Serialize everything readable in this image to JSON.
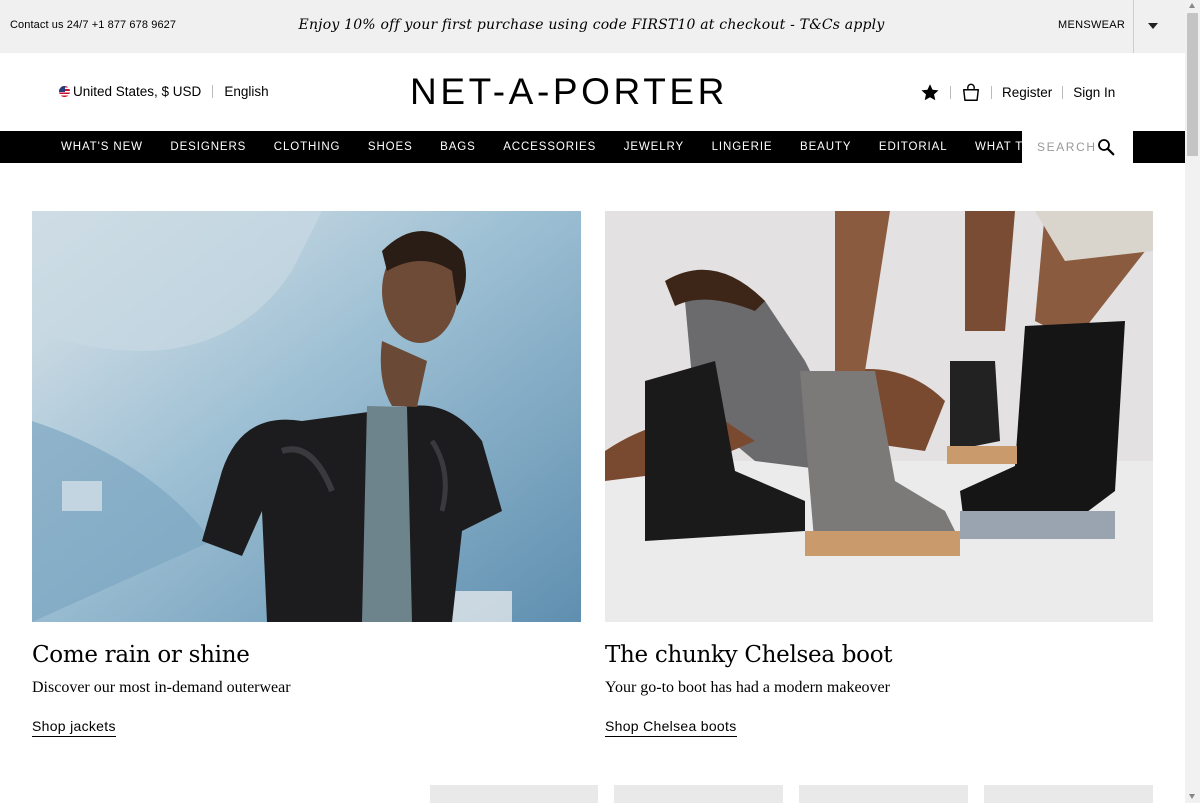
{
  "promo": {
    "contact": "Contact us 24/7 +1 877 678 9627",
    "message": "Enjoy 10% off your first purchase using code FIRST10 at checkout - T&Cs apply",
    "menswear": "MENSWEAR"
  },
  "header": {
    "region": "United States, $ USD",
    "language": "English",
    "logo": "NET-A-PORTER",
    "register": "Register",
    "sign_in": "Sign In"
  },
  "nav": {
    "items": [
      "WHAT'S NEW",
      "DESIGNERS",
      "CLOTHING",
      "SHOES",
      "BAGS",
      "ACCESSORIES",
      "JEWELRY",
      "LINGERIE",
      "BEAUTY",
      "EDITORIAL",
      "WHAT TO WEAR"
    ],
    "search_placeholder": "SEARCH"
  },
  "cards": [
    {
      "title": "Come rain or shine",
      "subtitle": "Discover our most in-demand outerwear",
      "link": "Shop jackets"
    },
    {
      "title": "The chunky Chelsea boot",
      "subtitle": "Your go-to boot has had a modern makeover",
      "link": "Shop Chelsea boots"
    }
  ],
  "colors": {
    "promo_bg": "#f0f0f0",
    "nav_bg": "#000000",
    "text": "#000000"
  }
}
